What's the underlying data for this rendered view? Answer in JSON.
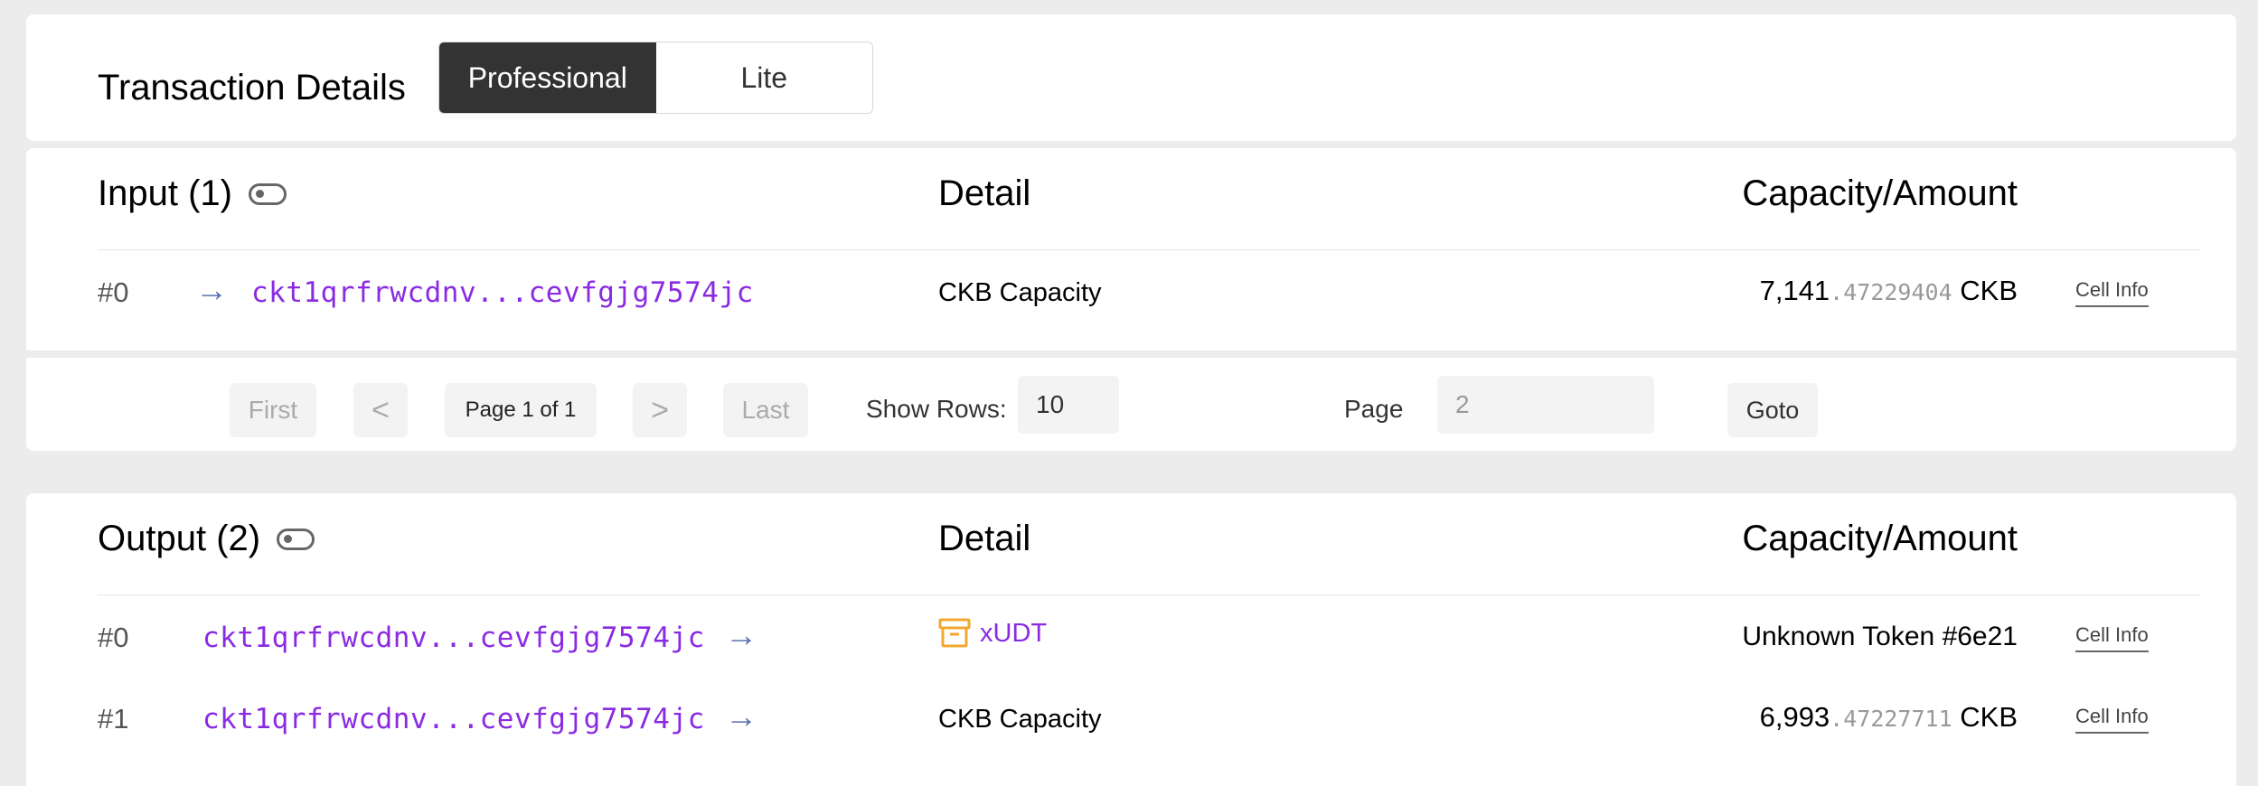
{
  "header": {
    "title": "Transaction Details",
    "modes": [
      "Professional",
      "Lite"
    ]
  },
  "input": {
    "title": "Input (1)",
    "columns": {
      "detail": "Detail",
      "amount": "Capacity/Amount"
    },
    "rows": [
      {
        "index": "#0",
        "address": "ckt1qrfrwcdnv...cevfgjg7574jc",
        "detail": "CKB Capacity",
        "amount_int": "7,141",
        "amount_dec": ".47229404",
        "unit": " CKB",
        "cell_info": "Cell Info"
      }
    ],
    "pagination": {
      "first": "First",
      "prev": "<",
      "page_of": "Page 1 of 1",
      "next": ">",
      "last": "Last",
      "show_rows_label": "Show Rows:",
      "show_rows_value": "10",
      "page_label": "Page",
      "page_placeholder": "2",
      "goto": "Goto"
    }
  },
  "output": {
    "title": "Output (2)",
    "columns": {
      "detail": "Detail",
      "amount": "Capacity/Amount"
    },
    "rows": [
      {
        "index": "#0",
        "address": "ckt1qrfrwcdnv...cevfgjg7574jc",
        "detail": "xUDT",
        "amount": "Unknown Token #6e21",
        "cell_info": "Cell Info"
      },
      {
        "index": "#1",
        "address": "ckt1qrfrwcdnv...cevfgjg7574jc",
        "detail": "CKB Capacity",
        "amount_int": "6,993",
        "amount_dec": ".47227711",
        "unit": " CKB",
        "cell_info": "Cell Info"
      }
    ]
  },
  "colors": {
    "accent": "#8a2be2",
    "arrow": "#5a6fb0",
    "active_mode": "#333333",
    "xudt_icon": "#f0a830"
  },
  "icons": {
    "row_arrow": "arrow-right-icon",
    "toggle": "toggle-icon",
    "xudt": "box-icon"
  }
}
